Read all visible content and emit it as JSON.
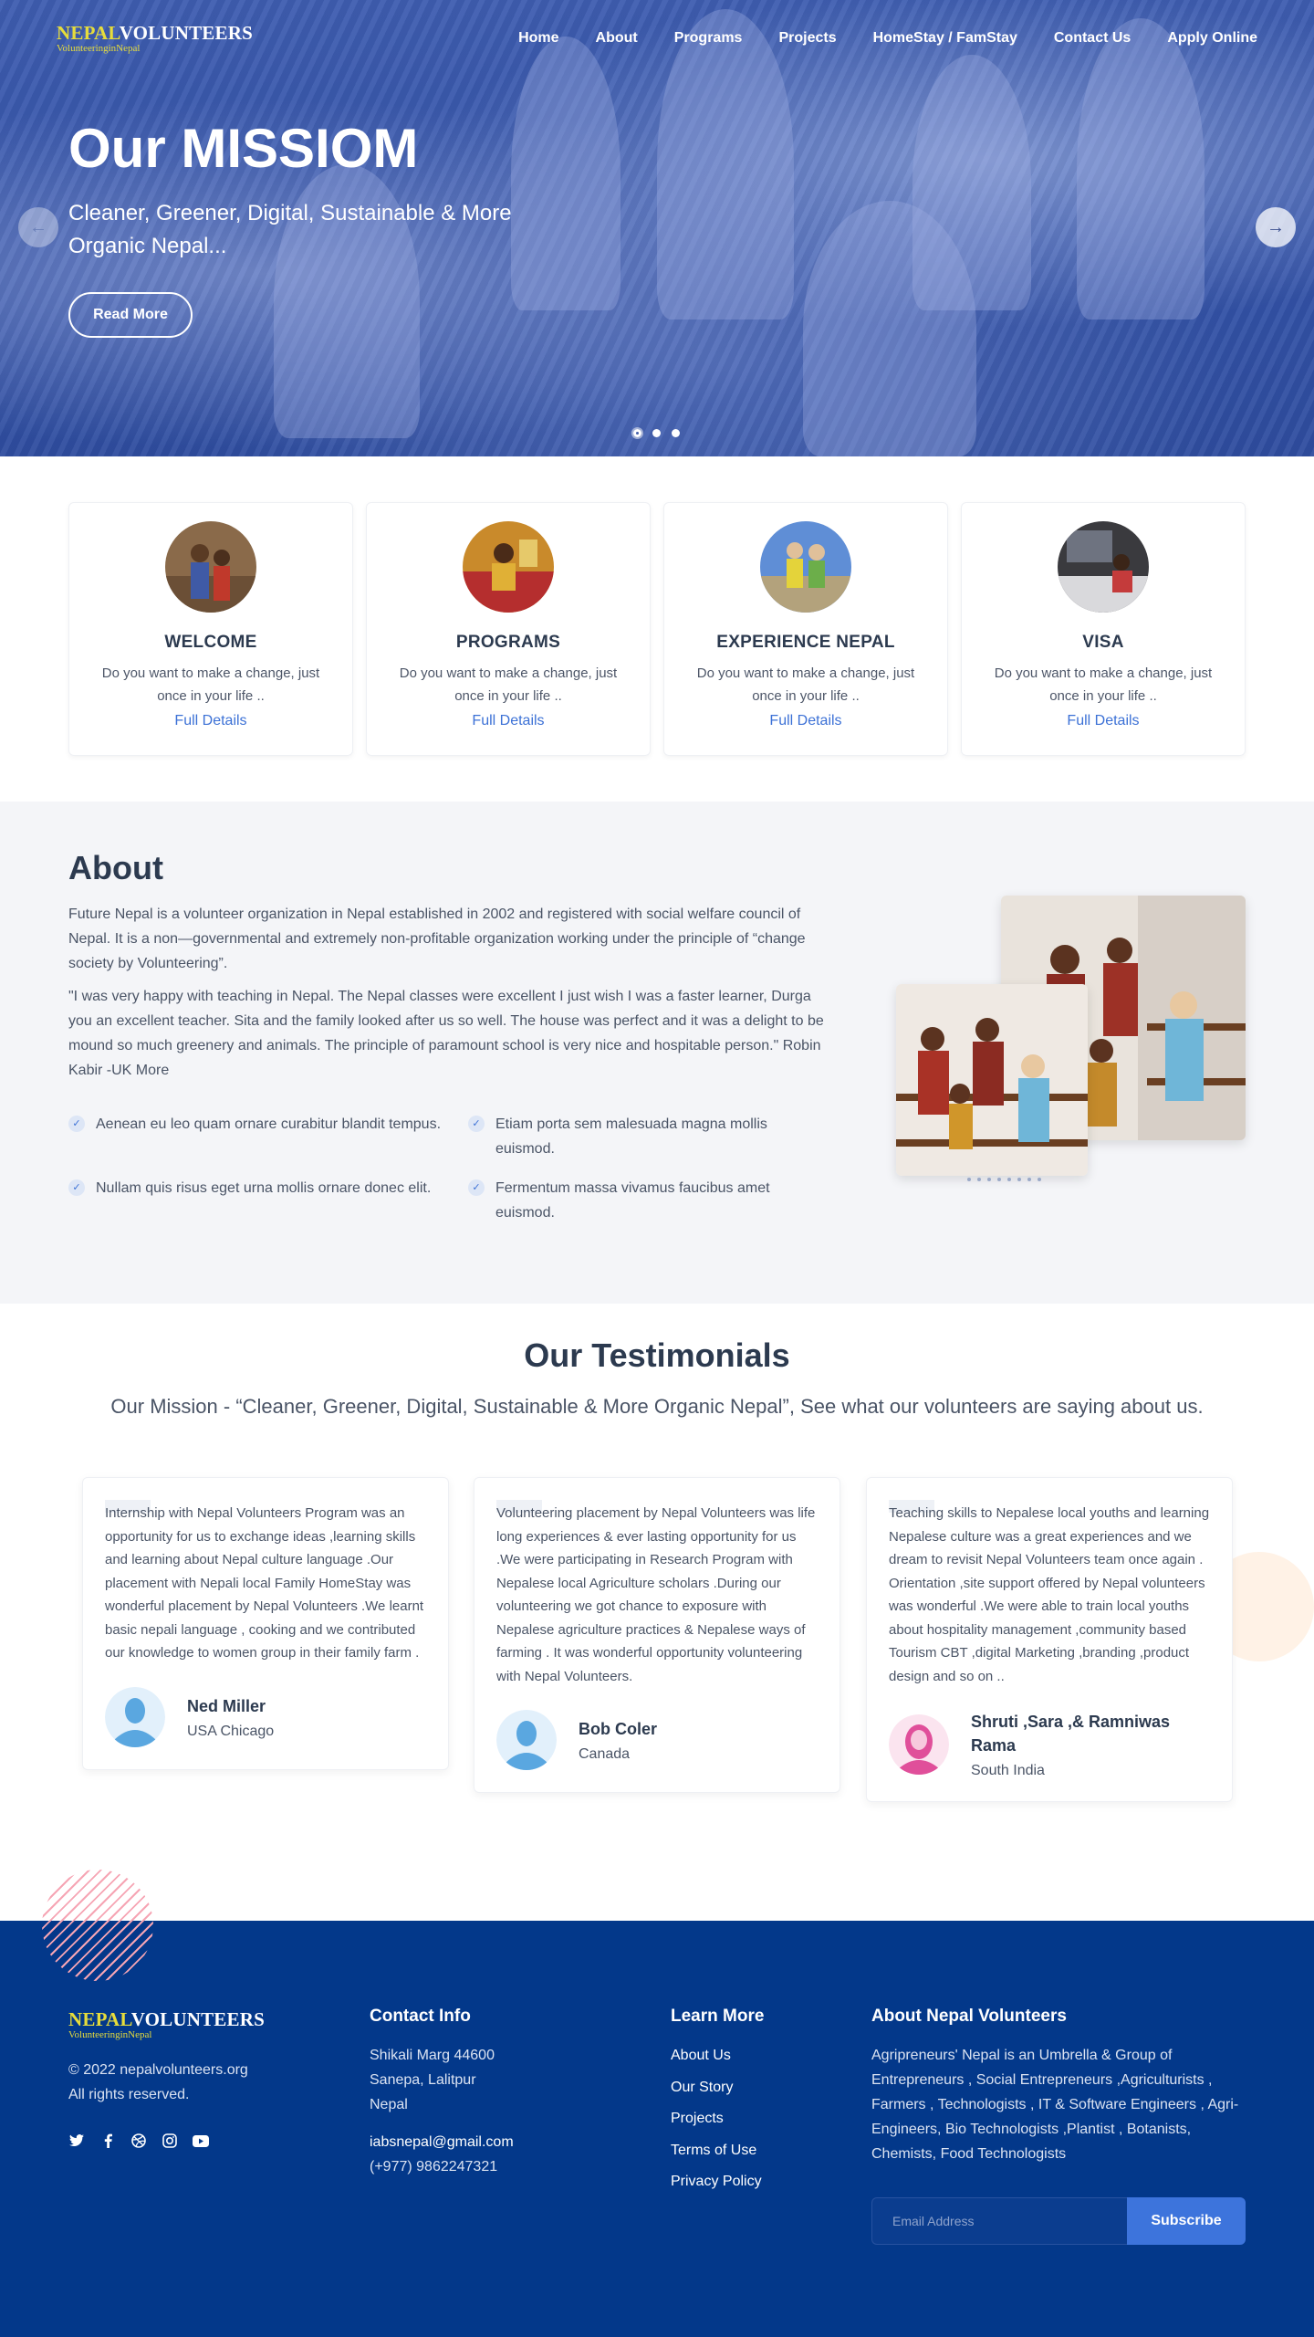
{
  "brand": {
    "logo_yellow": "NEPAL",
    "logo_white": "VOLUNTEERS",
    "logo_sub": "VolunteeringinNepal"
  },
  "nav": {
    "items": [
      "Home",
      "About",
      "Programs",
      "Projects",
      "HomeStay / FamStay",
      "Contact Us",
      "Apply Online"
    ]
  },
  "hero": {
    "title": "Our MISSIOM",
    "subtitle": "Cleaner, Greener, Digital, Sustainable & More Organic Nepal...",
    "button": "Read More",
    "prev_icon": "arrow-left-icon",
    "next_icon": "arrow-right-icon",
    "slides": 3,
    "active_slide": 1
  },
  "features": [
    {
      "title": "WELCOME",
      "text": "Do you want to make a change, just once in your life ..",
      "link": "Full Details"
    },
    {
      "title": "PROGRAMS",
      "text": "Do you want to make a change, just once in your life ..",
      "link": "Full Details"
    },
    {
      "title": "EXPERIENCE NEPAL",
      "text": "Do you want to make a change, just once in your life ..",
      "link": "Full Details"
    },
    {
      "title": "VISA",
      "text": "Do you want to make a change, just once in your life ..",
      "link": "Full Details"
    }
  ],
  "about": {
    "title": "About",
    "p1": "Future Nepal is a volunteer organization in Nepal established in 2002 and registered with social welfare council of Nepal. It is a non—governmental and extremely non-profitable organization working under the principle of “change society by Volunteering”.",
    "p2": "\"I was very happy with teaching in Nepal. The Nepal classes were excellent I just wish I was a faster learner, Durga you an excellent teacher. Sita and the family looked after us so well. The house was perfect and it was a delight to be mound so much greenery and animals. The principle of paramount school is very nice and hospitable person.\" Robin Kabir -UK More",
    "checks": [
      "Aenean eu leo quam ornare curabitur blandit tempus.",
      "Etiam porta sem malesuada magna mollis euismod.",
      "Nullam quis risus eget urna mollis ornare donec elit.",
      "Fermentum massa vivamus faucibus amet euismod."
    ]
  },
  "testimonials": {
    "title": "Our Testimonials",
    "lead": "Our Mission - “Cleaner, Greener, Digital, Sustainable & More Organic Nepal”, See what our volunteers are saying about us.",
    "items": [
      {
        "quote": "Internship with Nepal Volunteers Program was an opportunity for us to exchange ideas ,learning skills and learning about Nepal culture language .Our placement with Nepali local Family HomeStay was wonderful placement by Nepal Volunteers .We learnt basic nepali language , cooking and we contributed our knowledge to women group in their family farm .",
        "name": "Ned Miller",
        "location": "USA Chicago"
      },
      {
        "quote": "Volunteering placement by Nepal Volunteers was life long experiences & ever lasting opportunity for us .We were participating in Research Program with Nepalese local Agriculture scholars .During our volunteering we got chance to exposure with Nepalese agriculture practices & Nepalese ways of farming . It was wonderful opportunity volunteering with Nepal Volunteers.",
        "name": "Bob Coler",
        "location": "Canada"
      },
      {
        "quote": "Teaching skills to Nepalese local youths and learning Nepalese culture was a great experiences and we dream to revisit Nepal Volunteers team once again . Orientation ,site support offered by Nepal volunteers was wonderful .We were able to train local youths about hospitality management ,community based Tourism CBT ,digital Marketing ,branding ,product design and so on ..",
        "name": "Shruti ,Sara ,& Ramniwas Rama",
        "location": "South India"
      }
    ]
  },
  "footer": {
    "copyright": "© 2022 nepalvolunteers.org",
    "rights": "All rights reserved.",
    "social_icons": [
      "twitter-icon",
      "facebook-icon",
      "dribbble-icon",
      "instagram-icon",
      "youtube-icon"
    ],
    "contact": {
      "title": "Contact Info",
      "address1": "Shikali Marg 44600",
      "address2": "Sanepa, Lalitpur",
      "address3": "Nepal",
      "email": "iabsnepal@gmail.com",
      "phone": "(+977) 9862247321"
    },
    "learn": {
      "title": "Learn More",
      "links": [
        "About Us",
        "Our Story",
        "Projects",
        "Terms of Use",
        "Privacy Policy"
      ]
    },
    "about": {
      "title": "About Nepal Volunteers",
      "text": "Agripreneurs' Nepal is an Umbrella & Group of Entrepreneurs , Social Entrepreneurs ,Agriculturists , Farmers , Technologists , IT & Software Engineers , Agri-Engineers, Bio Technologists ,Plantist , Botanists, Chemists, Food Technologists"
    },
    "newsletter": {
      "placeholder": "Email Address",
      "button": "Subscribe"
    }
  },
  "colors": {
    "primary": "#3c71d6",
    "footer_bg": "#03388a",
    "logo_yellow": "#e6dc3b",
    "heading": "#2c3a4f"
  }
}
